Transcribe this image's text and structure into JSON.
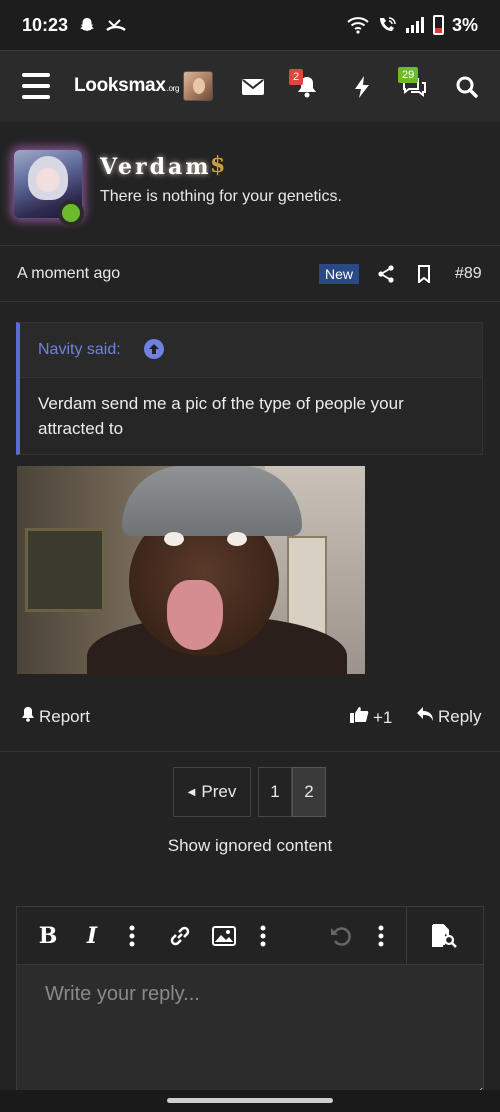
{
  "status_bar": {
    "time": "10:23",
    "battery": "3%",
    "icons": [
      "snapchat-icon",
      "missed-call-icon",
      "wifi-icon",
      "wifi-calling-icon",
      "signal-icon",
      "battery-icon"
    ]
  },
  "navbar": {
    "logo_main": "Looksmax",
    "logo_suffix": ".org",
    "alerts_count": "2",
    "conversations_count": "29",
    "colors": {
      "badge_red": "#e0463b",
      "badge_green": "#6dbb2c"
    }
  },
  "profile": {
    "username": "Verdam",
    "rank_symbol": "$",
    "user_title": "There is nothing for your genetics."
  },
  "post": {
    "time": "A moment ago",
    "new_label": "New",
    "post_number": "#89",
    "quote": {
      "author_label": "Navity said:",
      "text": "Verdam send me a pic of the type of people your attracted to"
    },
    "actions": {
      "report": "Report",
      "like": "+1",
      "reply": "Reply"
    }
  },
  "pagination": {
    "prev": "Prev",
    "pages": [
      "1",
      "2"
    ],
    "current": "2"
  },
  "show_ignored": "Show ignored content",
  "editor": {
    "placeholder": "Write your reply..."
  },
  "colors": {
    "background": "#232323",
    "accent_blue": "#6f82e0",
    "new_badge": "#2a4a86",
    "online": "#6dbb2c"
  }
}
